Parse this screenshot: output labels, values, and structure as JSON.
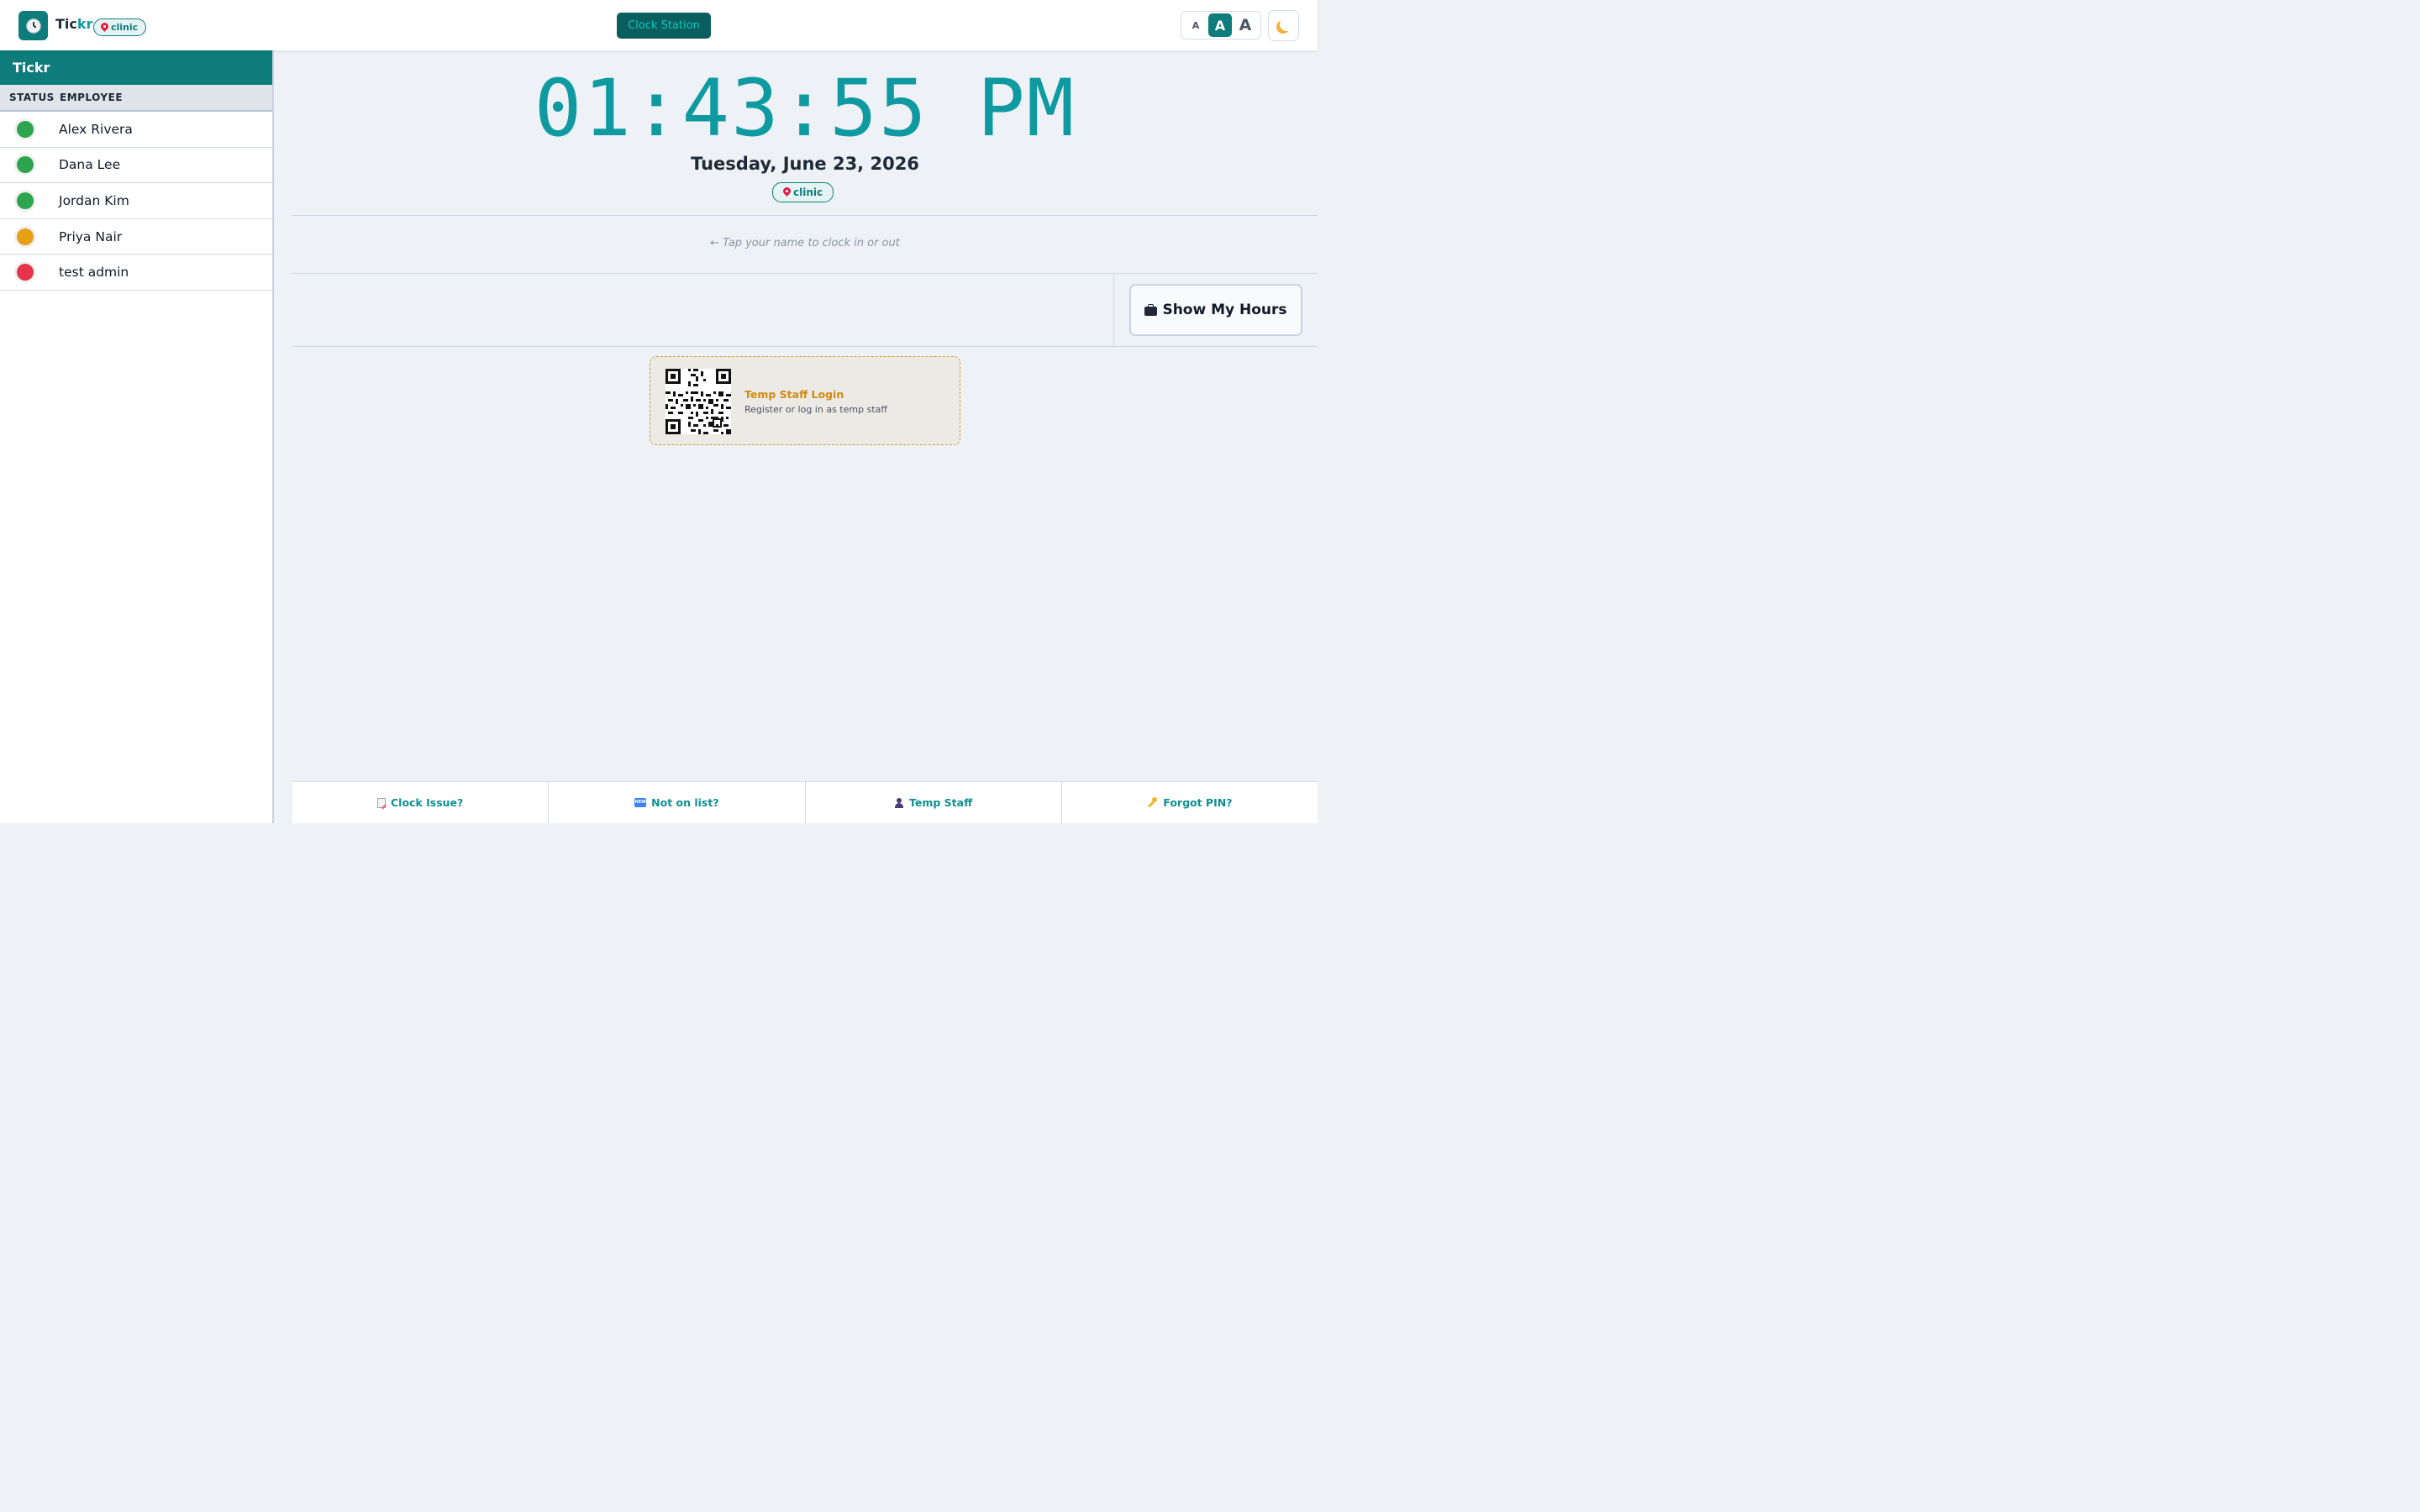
{
  "header": {
    "brand_main": "Tic",
    "brand_accent": "kr",
    "location": "clinic",
    "clock_station_label": "Clock Station",
    "font_sizes": [
      "A",
      "A",
      "A"
    ],
    "selected_font_size": 1,
    "dark_mode_icon": "moon-icon",
    "logo_icon": "clock-icon"
  },
  "sidebar": {
    "title": "Tickr",
    "columns": [
      "STATUS",
      "EMPLOYEE"
    ],
    "employees": [
      {
        "name": "Alex Rivera",
        "status": "in",
        "color": "#2da44e"
      },
      {
        "name": "Dana Lee",
        "status": "in",
        "color": "#2da44e"
      },
      {
        "name": "Jordan Kim",
        "status": "in",
        "color": "#2da44e"
      },
      {
        "name": "Priya Nair",
        "status": "break",
        "color": "#e6a017"
      },
      {
        "name": "test admin",
        "status": "out",
        "color": "#e5344a"
      }
    ]
  },
  "main": {
    "time": "01:43:55 PM",
    "date": "Tuesday, June 23, 2026",
    "location": "clinic",
    "hint": "← Tap your name to clock in or out",
    "show_hours_label": "Show My Hours",
    "temp_card": {
      "title": "Temp Staff Login",
      "subtitle": "Register or log in as temp staff"
    }
  },
  "footer": {
    "items": [
      {
        "label": "Clock Issue?",
        "icon": "note-icon"
      },
      {
        "label": "Not on list?",
        "icon": "new-badge-icon"
      },
      {
        "label": "Temp Staff",
        "icon": "user-icon"
      },
      {
        "label": "Forgot PIN?",
        "icon": "key-icon"
      }
    ]
  },
  "colors": {
    "teal": "#0e7c7b",
    "accent": "#0e9aa0",
    "temp_orange": "#d48a12"
  }
}
